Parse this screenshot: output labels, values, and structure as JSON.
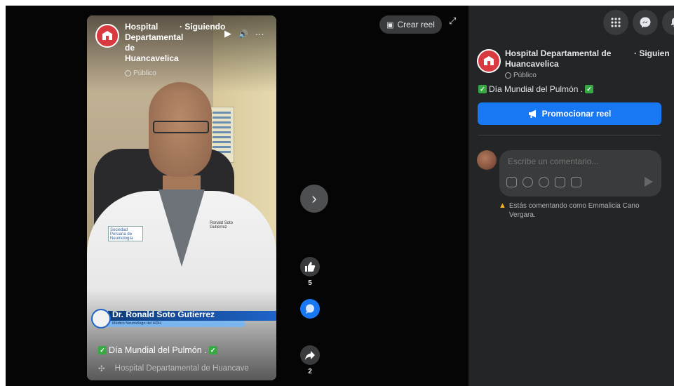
{
  "video": {
    "page_name": "Hospital Departamental de Huancavelica",
    "follow_label": "· Siguiendo",
    "privacy": "Público",
    "controls": {
      "play": "▶",
      "volume": "🔊",
      "more": "···"
    },
    "lower_third": {
      "name": "Dr. Ronald Soto Gutierrez",
      "title": "Médico Neumólogo del HDH"
    },
    "coat_badge": "Sociedad Peruana de Neumología",
    "coat_name": "Ronald Soto Gutierrez",
    "caption": "Día Mundial del Pulmón .",
    "audio_label": "Hospital Departamental de Huancave"
  },
  "stage": {
    "create_reel_label": "Crear reel",
    "next_label": "›",
    "actions": {
      "likes": "5",
      "shares": "2"
    }
  },
  "panel": {
    "page_name": "Hospital Departamental de Huancavelica",
    "follow_label": "· Siguien",
    "privacy": "Público",
    "description": "Día Mundial del Pulmón .",
    "promote_label": "Promocionar reel",
    "comment_placeholder": "Escribe un comentario...",
    "warning": "Estás comentando como Emmalicia Cano Vergara."
  },
  "colors": {
    "accent": "#1877f2",
    "panel_bg": "#242526",
    "check_green": "#38a845",
    "avatar_red": "#d93a3f"
  }
}
